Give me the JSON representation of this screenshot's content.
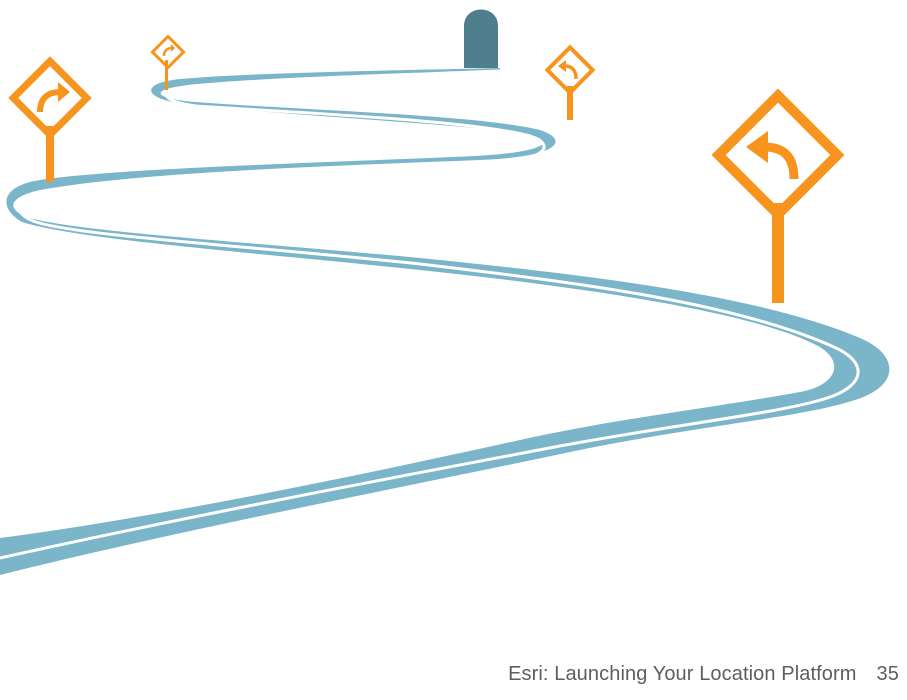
{
  "page": {
    "footer_title": "Esri: Launching Your Location Platform",
    "page_number": "35"
  },
  "illustration": {
    "road_color": "#7ab5ca",
    "road_line_color": "#ffffff",
    "tunnel_color": "#4f7f8d",
    "sign_color": "#f7941d",
    "signs": [
      {
        "name": "right-turn-sign",
        "icon": "right-curve-arrow-icon"
      },
      {
        "name": "right-turn-sign",
        "icon": "right-curve-arrow-icon"
      },
      {
        "name": "left-turn-sign",
        "icon": "left-curve-arrow-icon"
      },
      {
        "name": "left-turn-sign",
        "icon": "left-curve-arrow-icon"
      }
    ]
  }
}
